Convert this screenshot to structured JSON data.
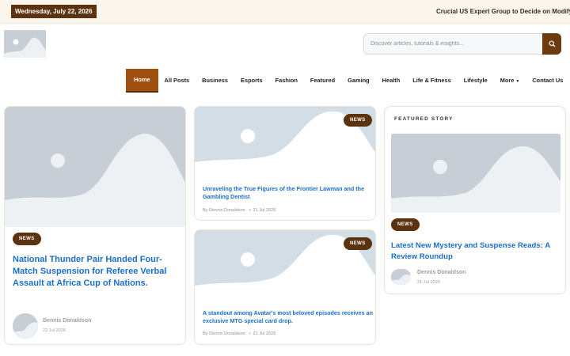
{
  "topbar": {
    "date": "Wednesday, July 22, 2026",
    "ticker": "Crucial US Expert Group to Decide on Modifying Baby H"
  },
  "header": {
    "logo_icon": "image-placeholder-icon",
    "search": {
      "placeholder": "Discover articles, tutorials & insights...",
      "value": ""
    }
  },
  "nav": {
    "items": [
      "Home",
      "All Posts",
      "Business",
      "Esports",
      "Fashion",
      "Featured",
      "Gaming",
      "Health",
      "Life & Fitness",
      "Lifestyle",
      "More",
      "Contact Us"
    ],
    "active": "Home"
  },
  "main_story": {
    "badge": "NEWS",
    "title": "National Thunder Pair Handed Four-Match Suspension for Referee Verbal Assault at Africa Cup of Nations.",
    "author": "Dennis Donaldson",
    "date": "22 Jul 2026"
  },
  "mid_stories": [
    {
      "badge": "NEWS",
      "title": "Unraveling the True Figures of the Frontier Lawman and the Gambling Dentist",
      "byline": "By Dennis Donaldson",
      "date": "21 Jul 2026"
    },
    {
      "badge": "NEWS",
      "title": "A standout among Avatar's most beloved episodes receives an exclusive MTG special card drop.",
      "byline": "By Dennis Donaldson",
      "date": "21 Jul 2026"
    }
  ],
  "featured": {
    "label": "FEATURED STORY",
    "badge": "NEWS",
    "title": "Latest New Mystery and Suspense Reads: A Review Roundup",
    "author": "Dennis Donaldson",
    "date": "21 Jul 2026"
  },
  "colors": {
    "accent": "#a0500e",
    "badge": "#5c3310",
    "link": "#1a6fc9",
    "placeholder": "#c7ced6"
  }
}
